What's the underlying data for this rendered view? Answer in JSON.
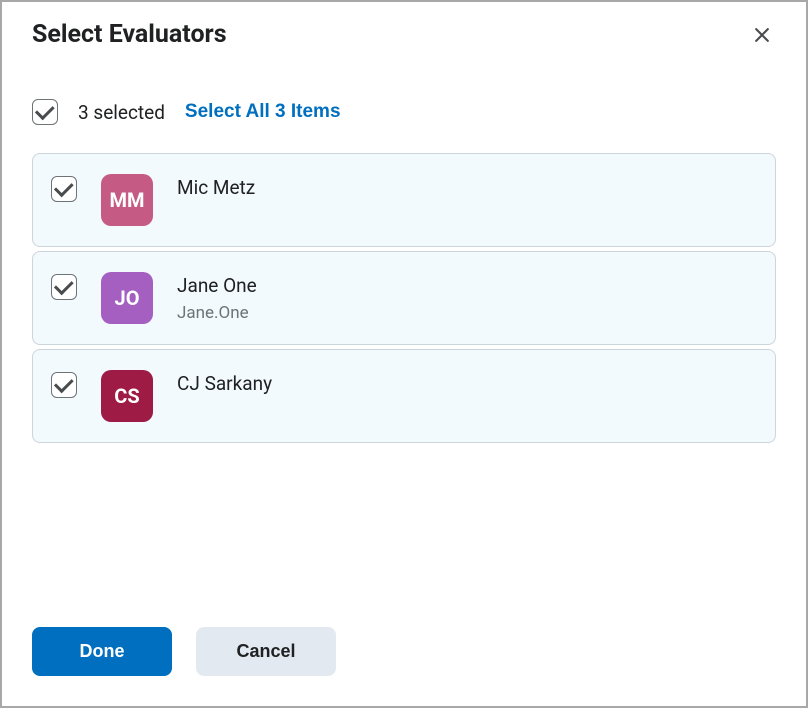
{
  "dialog": {
    "title": "Select Evaluators"
  },
  "selection": {
    "count_label": "3 selected",
    "select_all_label": "Select All 3 Items"
  },
  "evaluators": [
    {
      "initials": "MM",
      "name": "Mic Metz",
      "sub": "",
      "avatar_color": "#c55b84",
      "checked": true
    },
    {
      "initials": "JO",
      "name": "Jane One",
      "sub": "Jane.One",
      "avatar_color": "#a45fc1",
      "checked": true
    },
    {
      "initials": "CS",
      "name": "CJ Sarkany",
      "sub": "",
      "avatar_color": "#9e1b45",
      "checked": true
    }
  ],
  "footer": {
    "done_label": "Done",
    "cancel_label": "Cancel"
  }
}
